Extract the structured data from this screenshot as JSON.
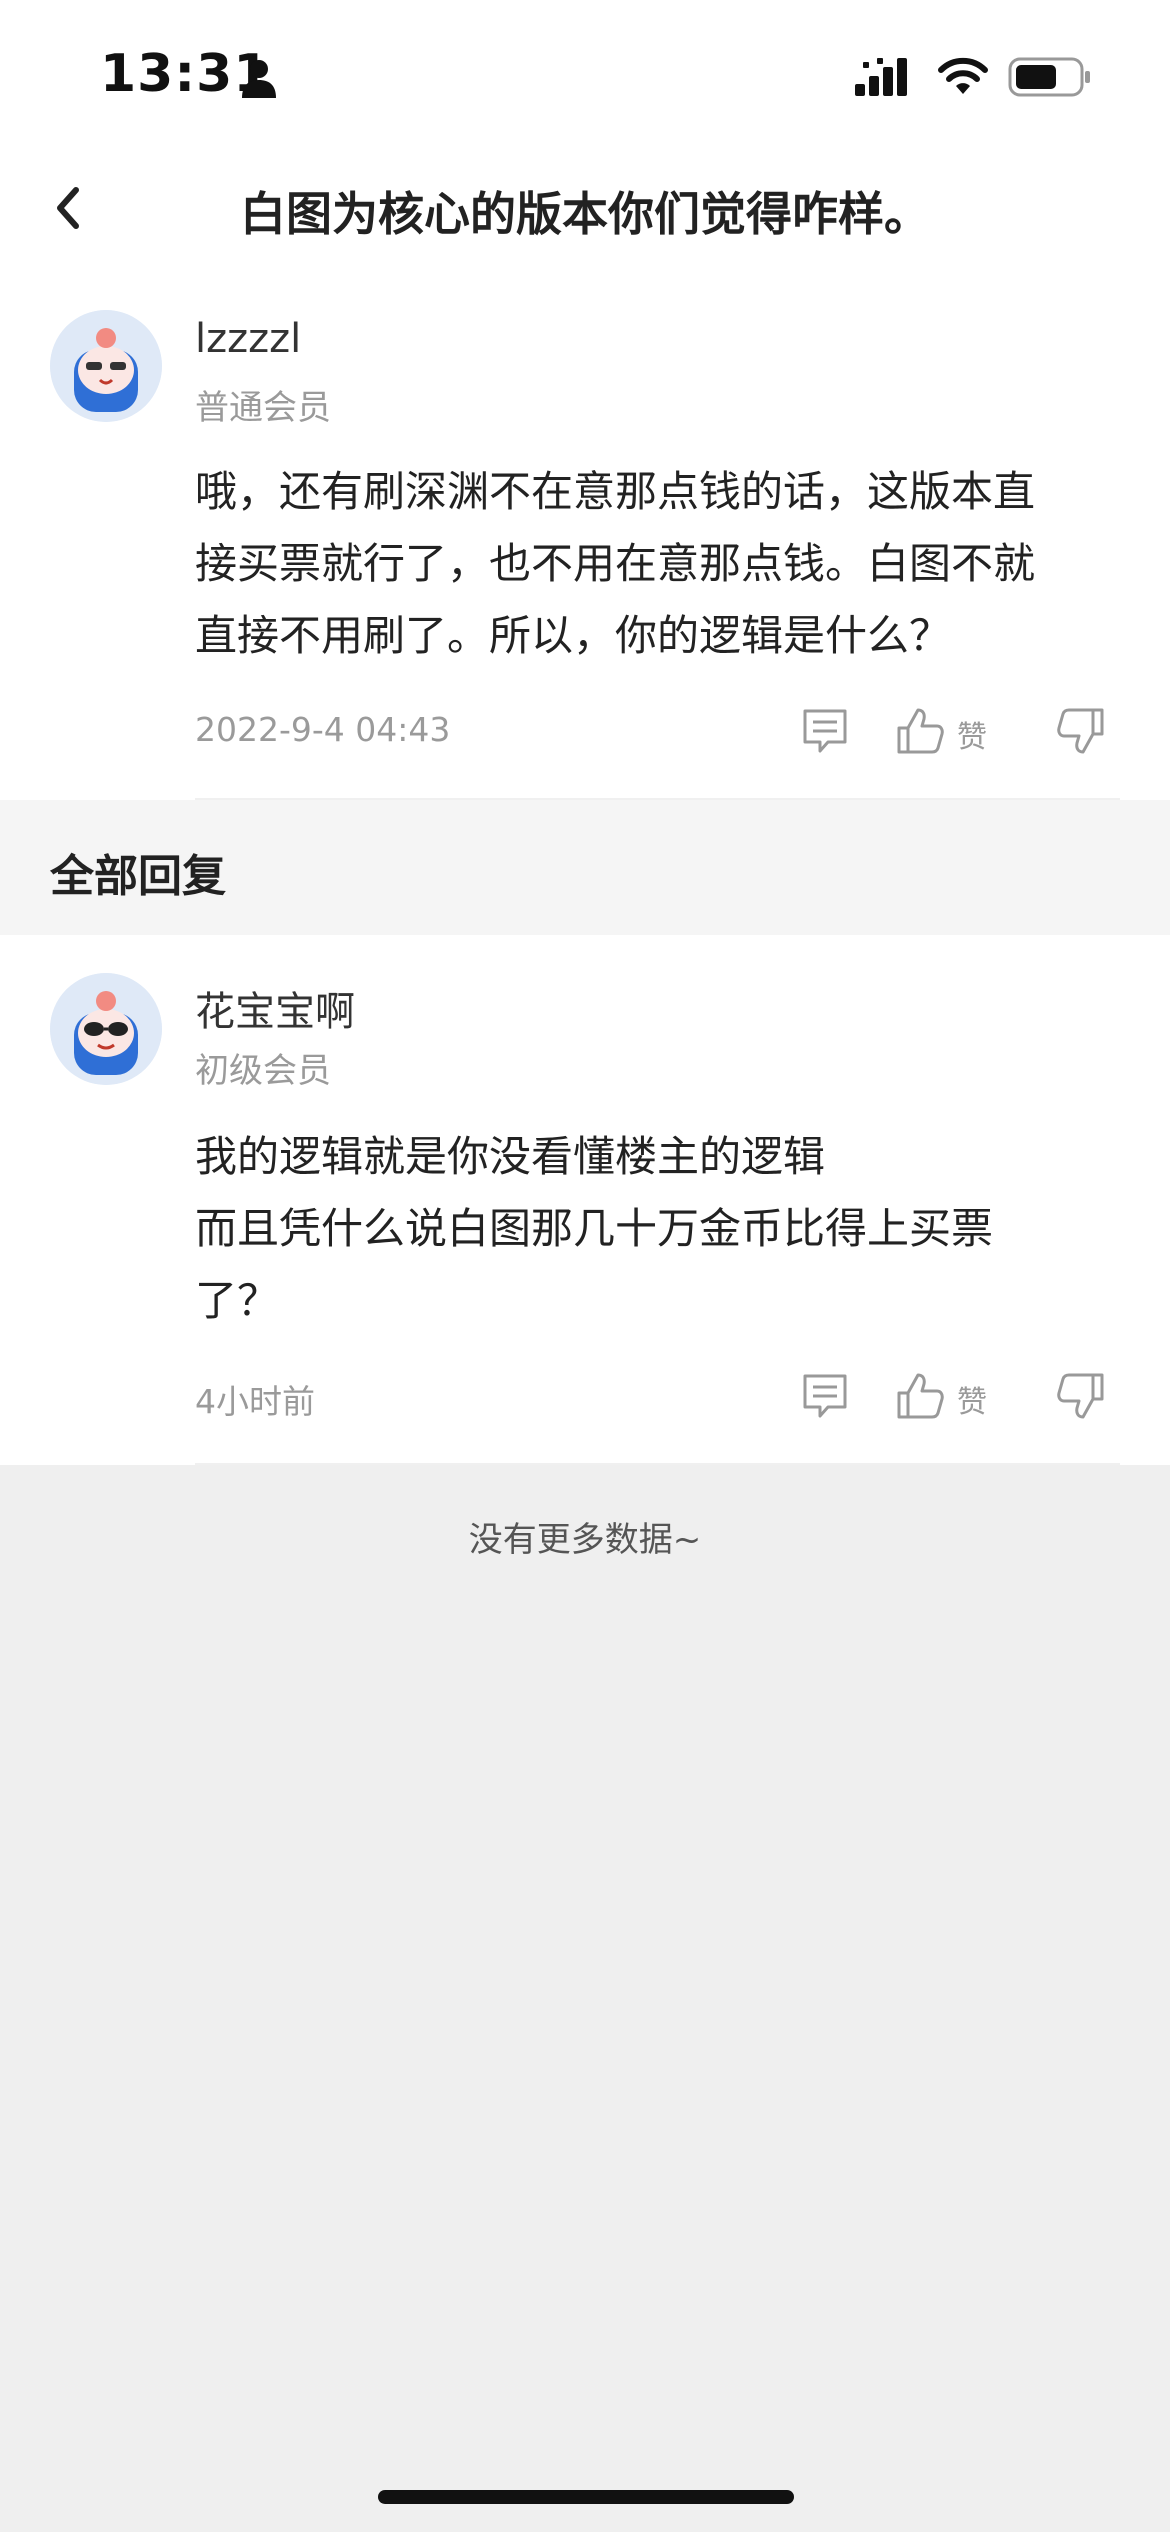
{
  "status_bar": {
    "time": "13:31"
  },
  "nav": {
    "title": "白图为核心的版本你们觉得咋样。"
  },
  "post": {
    "username": "lzzzzl",
    "member_level": "普通会员",
    "content_lines": [
      "哦，还有刷深渊不在意那点钱的话，这版本直",
      "接买票就行了，也不用在意那点钱。白图不就",
      "直接不用刷了。所以，你的逻辑是什么？"
    ],
    "time": "2022-9-4 04:43",
    "like_label": "赞"
  },
  "section": {
    "title": "全部回复"
  },
  "replies": [
    {
      "username": "花宝宝啊",
      "member_level": "初级会员",
      "content_lines": [
        "我的逻辑就是你没看懂楼主的逻辑",
        "而且凭什么说白图那几十万金币比得上买票",
        "了？"
      ],
      "time": "4小时前",
      "like_label": "赞"
    }
  ],
  "footer": {
    "no_more": "没有更多数据~"
  }
}
